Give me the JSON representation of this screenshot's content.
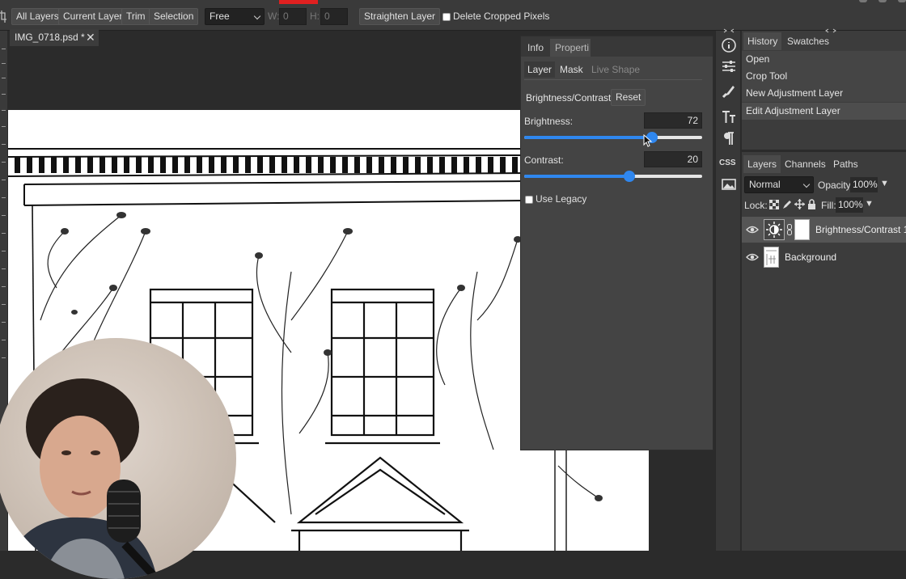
{
  "toolbar": {
    "all_layers": "All Layers",
    "current_layer": "Current Layer",
    "trim": "Trim",
    "selection": "Selection",
    "ratio_value": "Free",
    "w_label": "W:",
    "w_value": "0",
    "h_label": "H:",
    "h_value": "0",
    "straighten": "Straighten Layer",
    "delete_cropped": "Delete Cropped Pixels"
  },
  "document": {
    "tab_title": "IMG_0718.psd *"
  },
  "properties": {
    "tabs": [
      "Info",
      "Properti"
    ],
    "subtabs": [
      "Layer",
      "Mask",
      "Live Shape"
    ],
    "adjustment_title": "Brightness/Contrast",
    "reset": "Reset",
    "brightness_label": "Brightness:",
    "brightness_value": "72",
    "brightness_fraction": 0.72,
    "contrast_label": "Contrast:",
    "contrast_value": "20",
    "contrast_fraction": 0.59,
    "use_legacy": "Use Legacy"
  },
  "icons": {
    "side": [
      "info-icon",
      "adjustments-icon",
      "brush-icon",
      "character-icon",
      "paragraph-icon",
      "css-icon",
      "image-icon"
    ],
    "css_text": "CSS"
  },
  "history": {
    "tabs": [
      "History",
      "Swatches"
    ],
    "items": [
      "Open",
      "Crop Tool",
      "New Adjustment Layer",
      "Edit Adjustment Layer"
    ]
  },
  "layers": {
    "tabs": [
      "Layers",
      "Channels",
      "Paths"
    ],
    "blend_mode": "Normal",
    "opacity_label": "Opacity:",
    "opacity_value": "100%",
    "lock_label": "Lock:",
    "fill_label": "Fill:",
    "fill_value": "100%",
    "rows": [
      {
        "name": "Brightness/Contrast 1"
      },
      {
        "name": "Background"
      }
    ]
  },
  "colors": {
    "accent": "#2f87ef",
    "panel": "#444444",
    "canvas": "#ffffff"
  }
}
